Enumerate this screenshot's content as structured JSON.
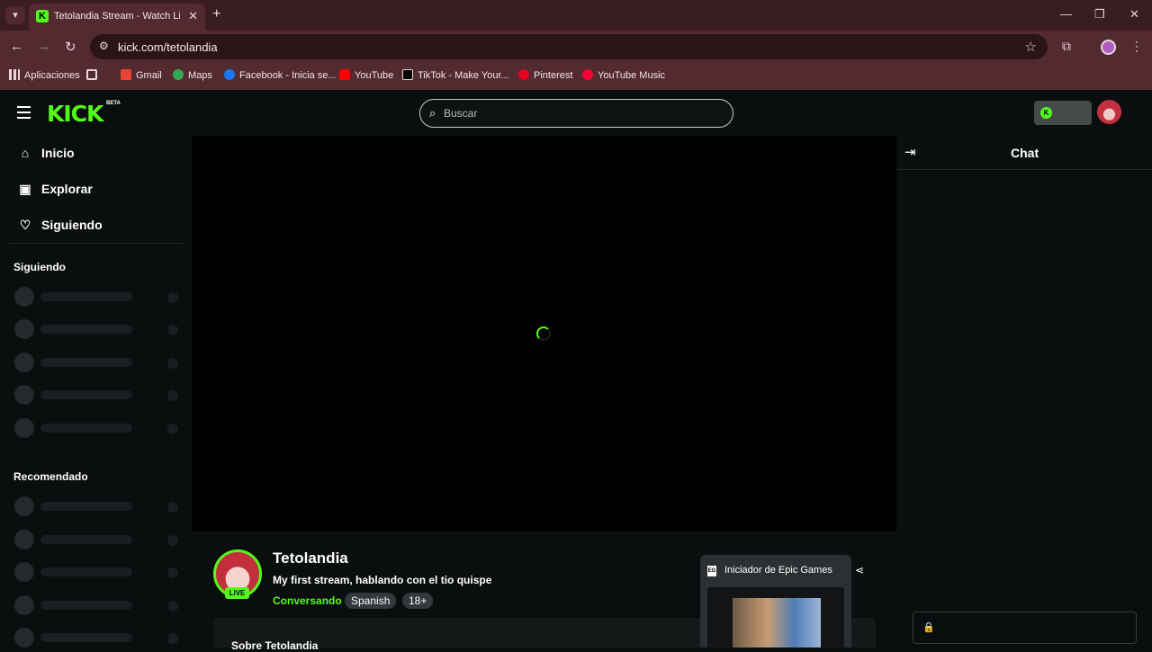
{
  "browser": {
    "tab_title": "Tetolandia Stream - Watch Live",
    "url": "kick.com/tetolandia",
    "bookmarks": [
      {
        "label": "Aplicaciones",
        "icon": "apps-grid-icon",
        "color": "#e8d8da"
      },
      {
        "label": "",
        "icon": "grid-icon",
        "color": "#e8d8da"
      },
      {
        "label": "Gmail",
        "icon": "gmail-icon",
        "color": "#ea4335"
      },
      {
        "label": "Maps",
        "icon": "maps-icon",
        "color": "#34a853"
      },
      {
        "label": "Facebook - Inicia se...",
        "icon": "facebook-icon",
        "color": "#1877f2"
      },
      {
        "label": "YouTube",
        "icon": "youtube-icon",
        "color": "#ff0000"
      },
      {
        "label": "TikTok - Make Your...",
        "icon": "tiktok-icon",
        "color": "#000000"
      },
      {
        "label": "Pinterest",
        "icon": "pinterest-icon",
        "color": "#e60023"
      },
      {
        "label": "YouTube Music",
        "icon": "youtube-music-icon",
        "color": "#ff0033"
      }
    ]
  },
  "header": {
    "logo": "KICK",
    "logo_badge": "BETA",
    "search_placeholder": "Buscar"
  },
  "sidebar": {
    "nav": [
      {
        "label": "Inicio",
        "icon": "home-icon"
      },
      {
        "label": "Explorar",
        "icon": "explore-icon"
      },
      {
        "label": "Siguiendo",
        "icon": "heart-icon"
      }
    ],
    "following_heading": "Siguiendo",
    "recommended_heading": "Recomendado"
  },
  "stream": {
    "streamer": "Tetolandia",
    "title": "My first stream, hablando con el tio quispe",
    "category": "Conversando",
    "tags": [
      "Spanish",
      "18+"
    ],
    "live_label": "LIVE",
    "about_label": "Sobre Tetolandia"
  },
  "popup": {
    "title": "Iniciador de Epic Games"
  },
  "chat": {
    "title": "Chat"
  },
  "colors": {
    "accent": "#53fc18",
    "browser_frame": "#542a31",
    "page_bg": "#0b0e0f"
  }
}
